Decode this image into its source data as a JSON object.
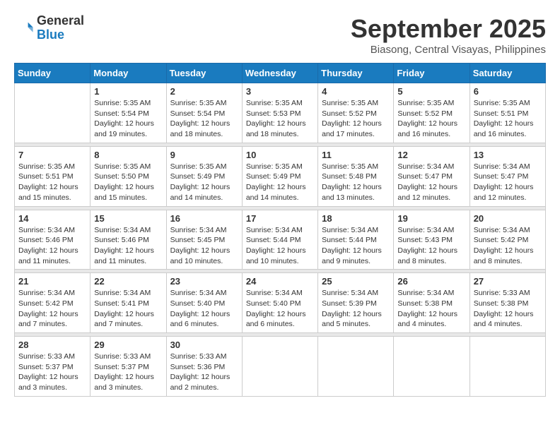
{
  "header": {
    "logo": {
      "general": "General",
      "blue": "Blue"
    },
    "title": "September 2025",
    "subtitle": "Biasong, Central Visayas, Philippines"
  },
  "weekdays": [
    "Sunday",
    "Monday",
    "Tuesday",
    "Wednesday",
    "Thursday",
    "Friday",
    "Saturday"
  ],
  "weeks": [
    [
      {
        "day": "",
        "info": ""
      },
      {
        "day": "1",
        "info": "Sunrise: 5:35 AM\nSunset: 5:54 PM\nDaylight: 12 hours\nand 19 minutes."
      },
      {
        "day": "2",
        "info": "Sunrise: 5:35 AM\nSunset: 5:54 PM\nDaylight: 12 hours\nand 18 minutes."
      },
      {
        "day": "3",
        "info": "Sunrise: 5:35 AM\nSunset: 5:53 PM\nDaylight: 12 hours\nand 18 minutes."
      },
      {
        "day": "4",
        "info": "Sunrise: 5:35 AM\nSunset: 5:52 PM\nDaylight: 12 hours\nand 17 minutes."
      },
      {
        "day": "5",
        "info": "Sunrise: 5:35 AM\nSunset: 5:52 PM\nDaylight: 12 hours\nand 16 minutes."
      },
      {
        "day": "6",
        "info": "Sunrise: 5:35 AM\nSunset: 5:51 PM\nDaylight: 12 hours\nand 16 minutes."
      }
    ],
    [
      {
        "day": "7",
        "info": "Sunrise: 5:35 AM\nSunset: 5:51 PM\nDaylight: 12 hours\nand 15 minutes."
      },
      {
        "day": "8",
        "info": "Sunrise: 5:35 AM\nSunset: 5:50 PM\nDaylight: 12 hours\nand 15 minutes."
      },
      {
        "day": "9",
        "info": "Sunrise: 5:35 AM\nSunset: 5:49 PM\nDaylight: 12 hours\nand 14 minutes."
      },
      {
        "day": "10",
        "info": "Sunrise: 5:35 AM\nSunset: 5:49 PM\nDaylight: 12 hours\nand 14 minutes."
      },
      {
        "day": "11",
        "info": "Sunrise: 5:35 AM\nSunset: 5:48 PM\nDaylight: 12 hours\nand 13 minutes."
      },
      {
        "day": "12",
        "info": "Sunrise: 5:34 AM\nSunset: 5:47 PM\nDaylight: 12 hours\nand 12 minutes."
      },
      {
        "day": "13",
        "info": "Sunrise: 5:34 AM\nSunset: 5:47 PM\nDaylight: 12 hours\nand 12 minutes."
      }
    ],
    [
      {
        "day": "14",
        "info": "Sunrise: 5:34 AM\nSunset: 5:46 PM\nDaylight: 12 hours\nand 11 minutes."
      },
      {
        "day": "15",
        "info": "Sunrise: 5:34 AM\nSunset: 5:46 PM\nDaylight: 12 hours\nand 11 minutes."
      },
      {
        "day": "16",
        "info": "Sunrise: 5:34 AM\nSunset: 5:45 PM\nDaylight: 12 hours\nand 10 minutes."
      },
      {
        "day": "17",
        "info": "Sunrise: 5:34 AM\nSunset: 5:44 PM\nDaylight: 12 hours\nand 10 minutes."
      },
      {
        "day": "18",
        "info": "Sunrise: 5:34 AM\nSunset: 5:44 PM\nDaylight: 12 hours\nand 9 minutes."
      },
      {
        "day": "19",
        "info": "Sunrise: 5:34 AM\nSunset: 5:43 PM\nDaylight: 12 hours\nand 8 minutes."
      },
      {
        "day": "20",
        "info": "Sunrise: 5:34 AM\nSunset: 5:42 PM\nDaylight: 12 hours\nand 8 minutes."
      }
    ],
    [
      {
        "day": "21",
        "info": "Sunrise: 5:34 AM\nSunset: 5:42 PM\nDaylight: 12 hours\nand 7 minutes."
      },
      {
        "day": "22",
        "info": "Sunrise: 5:34 AM\nSunset: 5:41 PM\nDaylight: 12 hours\nand 7 minutes."
      },
      {
        "day": "23",
        "info": "Sunrise: 5:34 AM\nSunset: 5:40 PM\nDaylight: 12 hours\nand 6 minutes."
      },
      {
        "day": "24",
        "info": "Sunrise: 5:34 AM\nSunset: 5:40 PM\nDaylight: 12 hours\nand 6 minutes."
      },
      {
        "day": "25",
        "info": "Sunrise: 5:34 AM\nSunset: 5:39 PM\nDaylight: 12 hours\nand 5 minutes."
      },
      {
        "day": "26",
        "info": "Sunrise: 5:34 AM\nSunset: 5:38 PM\nDaylight: 12 hours\nand 4 minutes."
      },
      {
        "day": "27",
        "info": "Sunrise: 5:33 AM\nSunset: 5:38 PM\nDaylight: 12 hours\nand 4 minutes."
      }
    ],
    [
      {
        "day": "28",
        "info": "Sunrise: 5:33 AM\nSunset: 5:37 PM\nDaylight: 12 hours\nand 3 minutes."
      },
      {
        "day": "29",
        "info": "Sunrise: 5:33 AM\nSunset: 5:37 PM\nDaylight: 12 hours\nand 3 minutes."
      },
      {
        "day": "30",
        "info": "Sunrise: 5:33 AM\nSunset: 5:36 PM\nDaylight: 12 hours\nand 2 minutes."
      },
      {
        "day": "",
        "info": ""
      },
      {
        "day": "",
        "info": ""
      },
      {
        "day": "",
        "info": ""
      },
      {
        "day": "",
        "info": ""
      }
    ]
  ]
}
